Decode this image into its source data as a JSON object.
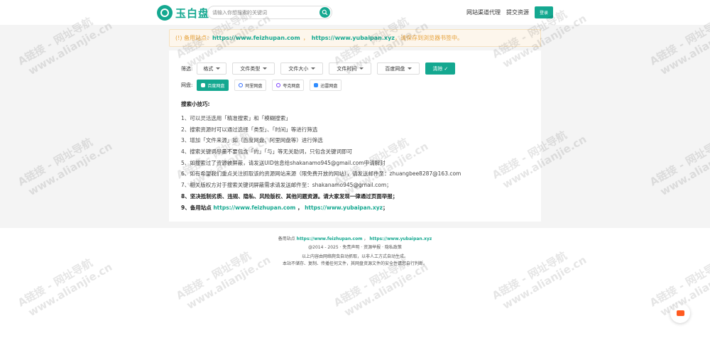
{
  "header": {
    "logo_text": "玉白盘",
    "search_placeholder": "请输入你想搜索的关键词",
    "nav": [
      "网站渠道代理",
      "提交资源"
    ],
    "login_label": "登录"
  },
  "notice": {
    "prefix": "(!) 备用站点：",
    "url1": "https://www.feizhupan.com",
    "sep": "，",
    "url2": "https://www.yubaipan.xyz",
    "suffix": "，请保存到浏览器书签中。"
  },
  "filters": {
    "label": "筛选:",
    "dropdowns": [
      "格式",
      "文件类型",
      "文件大小",
      "文件时间",
      "百度网盘"
    ],
    "clear_label": "清除"
  },
  "netdisks": {
    "label": "网盘:",
    "items": [
      "百度网盘",
      "阿里网盘",
      "夸克网盘",
      "迅雷网盘"
    ]
  },
  "tips": {
    "title": "搜索小技巧:",
    "items": [
      "1、可以灵活选用「精准搜索」和「模糊搜索」",
      "2、搜索资源时可以通过选择「类型」、「时间」等进行筛选",
      "3、增加「文件来源」如（百度网盘、阿里网盘等）进行筛选",
      "4、搜索关键词尽量不要包含「的」「与」等无关助词，只包含关键词即可",
      "5、如搜索过了资源被屏蔽，请发送UID信息给shakanamo945@gmail.com申请解封",
      "6、如有希望我们重点关注抓取该的资源网站来源（限免费开放的网站），请发送邮件至：zhuangbee8287@163.com",
      "7、相关版权方对于搜索关键词屏蔽需求请发送邮件至：shakanamo945@gmail.com；",
      "8、坚决抵制劣质、违规、隐私、风险版权、其他问题资源。请大家发现一律通过页面举报；"
    ],
    "last_prefix": "9、备用站点",
    "last_url1": "https://www.feizhupan.com",
    "last_sep": "，",
    "last_url2": "https://www.yubaipan.xyz",
    "last_suffix": "；"
  },
  "footer": {
    "prefix": "备用站点",
    "url1": "https://www.feizhupan.com",
    "sep": "，",
    "url2": "https://www.yubaipan.xyz",
    "copyright": "@2014 - 2025 · 免责声明 · 资源举报 · 隐私政策",
    "line3": "以上内容由网络爬虫自动抓取，以非人工方式自动生成。",
    "line4": "本站不储存、复制、传播任何文件，其网盘资源文件的安全性请您自行判断。"
  },
  "watermark": {
    "line1": "A链接 - 网址导航",
    "line2": "www.alianjie.cn"
  },
  "colors": {
    "brand": "#14a890",
    "warning": "#e6a23c",
    "chat": "#ff5a1f"
  }
}
